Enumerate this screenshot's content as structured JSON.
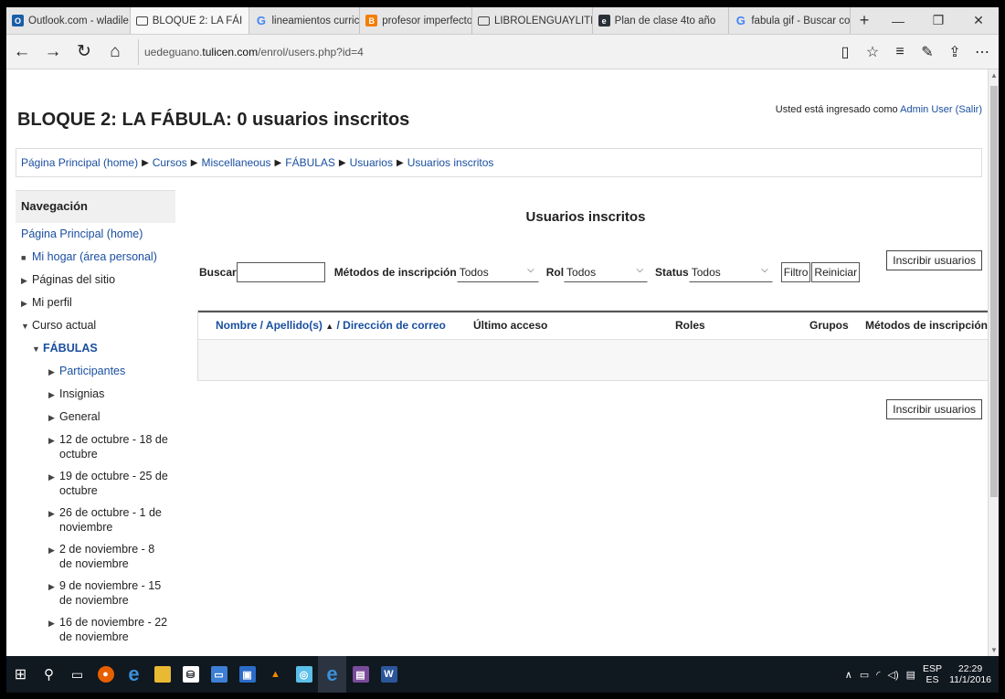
{
  "browser": {
    "tabs": [
      {
        "label": "Outlook.com - wladile",
        "icon": "outlook-icon",
        "active": false
      },
      {
        "label": "BLOQUE 2: LA FÁI",
        "icon": "page-icon",
        "active": true
      },
      {
        "label": "lineamientos curricula",
        "icon": "google-icon",
        "active": false
      },
      {
        "label": "profesor imperfecto...",
        "icon": "blogger-icon",
        "active": false
      },
      {
        "label": "LIBROLENGUAYLITERA",
        "icon": "page-icon",
        "active": false
      },
      {
        "label": "Plan de clase 4to año",
        "icon": "edmodo-icon",
        "active": false
      },
      {
        "label": "fabula gif - Buscar cor",
        "icon": "google-icon",
        "active": false
      }
    ],
    "tab_close": "✕",
    "new_tab": "+",
    "win_min": "—",
    "win_max": "❐",
    "win_close": "✕",
    "url_prefix": "uedeguano.",
    "url_domain": "tulicen.com",
    "url_path": "/enrol/users.php?id=4"
  },
  "page": {
    "title": "BLOQUE 2: LA FÁBULA: 0 usuarios inscritos",
    "login_text": "Usted está ingresado como ",
    "login_user": "Admin User",
    "login_logout": "(Salir)",
    "breadcrumb": [
      "Página Principal (home)",
      "Cursos",
      "Miscellaneous",
      "FÁBULAS",
      "Usuarios",
      "Usuarios inscritos"
    ]
  },
  "nav": {
    "header": "Navegación",
    "home": "Página Principal (home)",
    "items": [
      {
        "label": "Mi hogar (área personal)",
        "marker": "■",
        "level": 1,
        "link": true
      },
      {
        "label": "Páginas del sitio",
        "marker": "▶",
        "level": 1,
        "link": false
      },
      {
        "label": "Mi perfil",
        "marker": "▶",
        "level": 1,
        "link": false
      },
      {
        "label": "Curso actual",
        "marker": "▼",
        "level": 1,
        "link": false
      },
      {
        "label": "FÁBULAS",
        "marker": "▼",
        "level": 2,
        "link": true,
        "bold": true
      },
      {
        "label": "Participantes",
        "marker": "▶",
        "level": 3,
        "link": true
      },
      {
        "label": "Insignias",
        "marker": "▶",
        "level": 3,
        "link": false
      },
      {
        "label": "General",
        "marker": "▶",
        "level": 3,
        "link": false
      },
      {
        "label": "12 de octubre - 18 de octubre",
        "marker": "▶",
        "level": 3,
        "link": false
      },
      {
        "label": "19 de octubre - 25 de octubre",
        "marker": "▶",
        "level": 3,
        "link": false
      },
      {
        "label": "26 de octubre - 1 de noviembre",
        "marker": "▶",
        "level": 3,
        "link": false
      },
      {
        "label": "2 de noviembre - 8 de noviembre",
        "marker": "▶",
        "level": 3,
        "link": false
      },
      {
        "label": "9 de noviembre - 15 de noviembre",
        "marker": "▶",
        "level": 3,
        "link": false
      },
      {
        "label": "16 de noviembre - 22 de noviembre",
        "marker": "▶",
        "level": 3,
        "link": false
      }
    ]
  },
  "main": {
    "heading": "Usuarios inscritos",
    "enrol_button": "Inscribir usuarios",
    "search_label": "Buscar",
    "search_value": "",
    "methods_label": "Métodos de inscripción",
    "methods_value": "Todos",
    "role_label": "Rol",
    "role_value": "Todos",
    "status_label": "Status",
    "status_value": "Todos",
    "filter_button": "Filtro",
    "reset_button": "Reiniciar",
    "columns": {
      "name": "Nombre / Apellido(s)",
      "sort_glyph": "▲",
      "email": "/ Dirección de correo",
      "last_access": "Último acceso",
      "roles": "Roles",
      "groups": "Grupos",
      "methods": "Métodos de inscripción"
    }
  },
  "taskbar": {
    "lang_top": "ESP",
    "lang_bottom": "ES",
    "time": "22:29",
    "date": "11/1/2016"
  }
}
